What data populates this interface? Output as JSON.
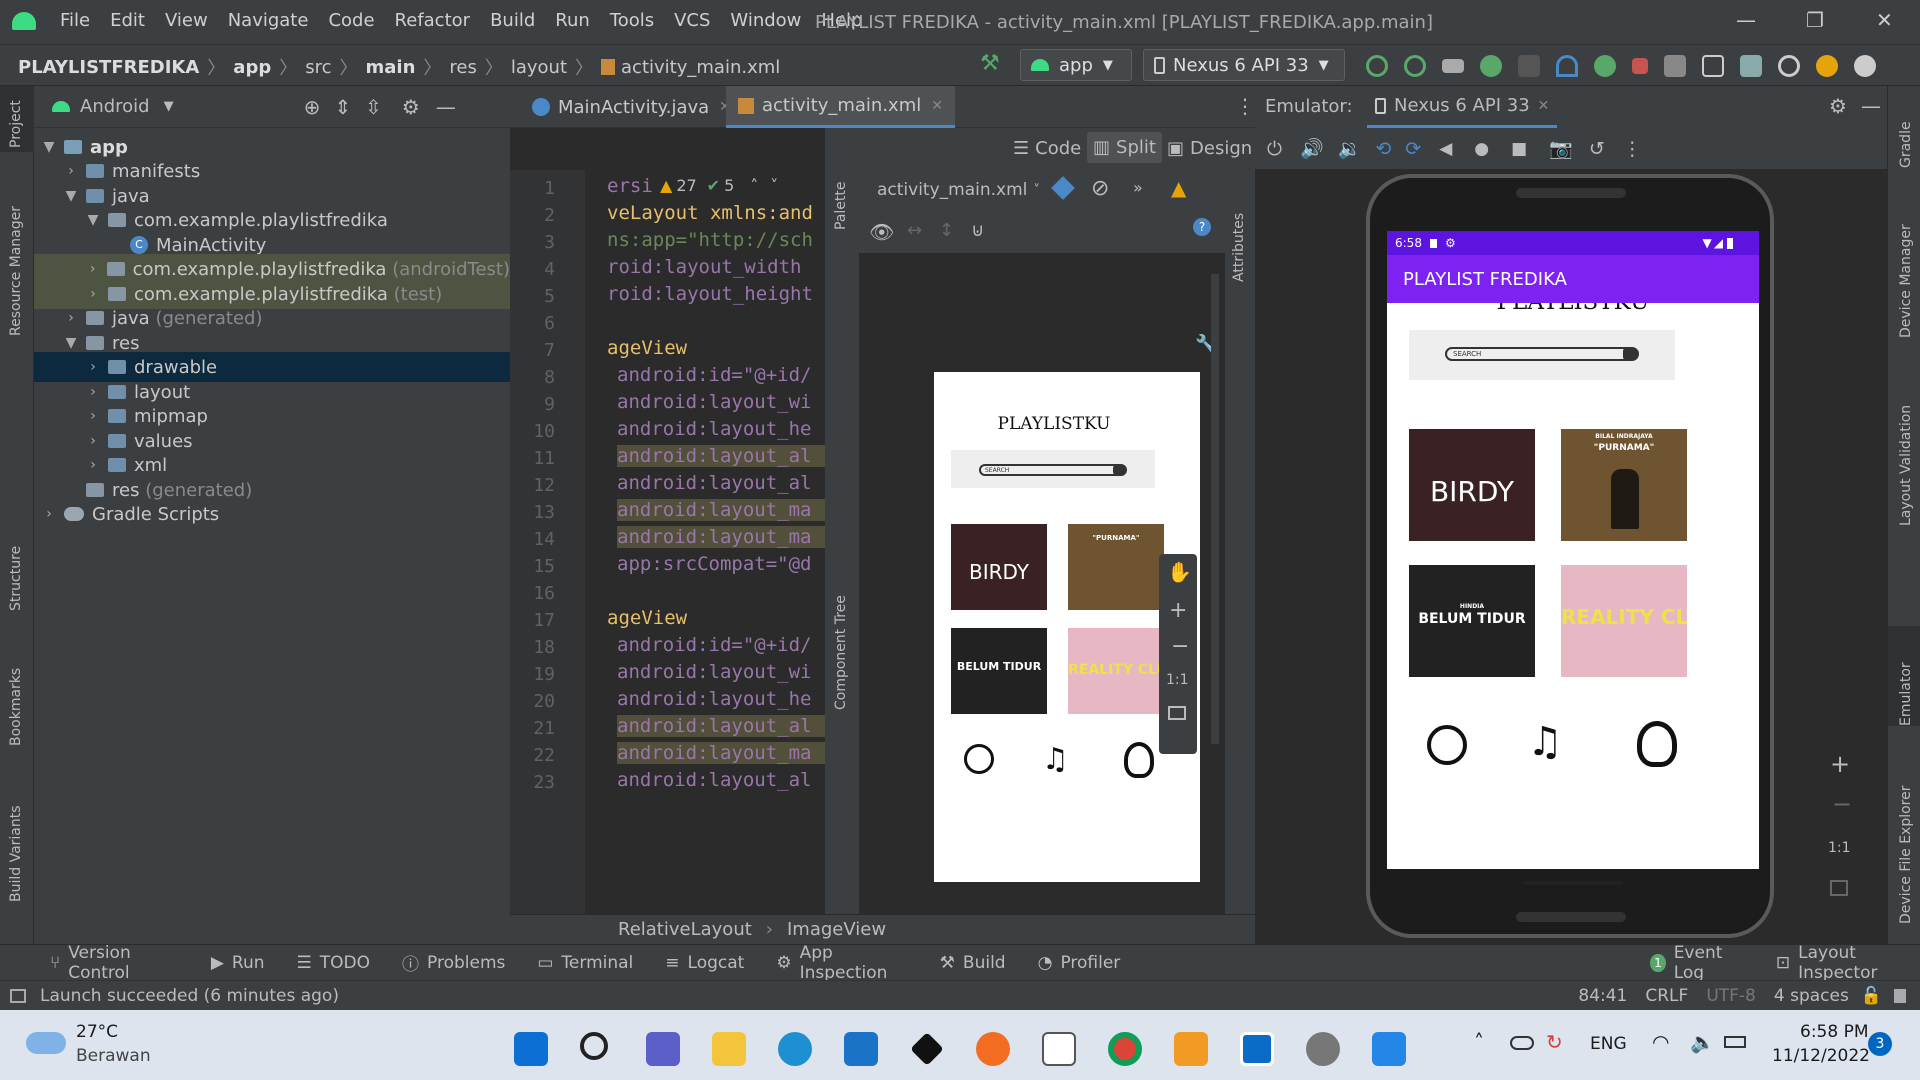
{
  "menubar": {
    "items": [
      "File",
      "Edit",
      "View",
      "Navigate",
      "Code",
      "Refactor",
      "Build",
      "Run",
      "Tools",
      "VCS",
      "Window",
      "Help"
    ],
    "title": "PLAYLIST FREDIKA - activity_main.xml [PLAYLIST_FREDIKA.app.main]"
  },
  "navbar": {
    "crumbs": [
      "PLAYLISTFREDIKA",
      "app",
      "src",
      "main",
      "res",
      "layout",
      "activity_main.xml"
    ],
    "run_config": "app",
    "device": "Nexus 6 API 33"
  },
  "project": {
    "view": "Android",
    "tree": [
      {
        "label": "app",
        "suffix": ""
      },
      {
        "label": "manifests",
        "suffix": ""
      },
      {
        "label": "java",
        "suffix": ""
      },
      {
        "label": "com.example.playlistfredika",
        "suffix": ""
      },
      {
        "label": "MainActivity",
        "suffix": ""
      },
      {
        "label": "com.example.playlistfredika",
        "suffix": "(androidTest)"
      },
      {
        "label": "com.example.playlistfredika",
        "suffix": "(test)"
      },
      {
        "label": "java",
        "suffix": "(generated)"
      },
      {
        "label": "res",
        "suffix": ""
      },
      {
        "label": "drawable",
        "suffix": ""
      },
      {
        "label": "layout",
        "suffix": ""
      },
      {
        "label": "mipmap",
        "suffix": ""
      },
      {
        "label": "values",
        "suffix": ""
      },
      {
        "label": "xml",
        "suffix": ""
      },
      {
        "label": "res",
        "suffix": "(generated)"
      },
      {
        "label": "Gradle Scripts",
        "suffix": ""
      }
    ]
  },
  "left_tool_labels": [
    "Project",
    "Resource Manager",
    "Structure",
    "Bookmarks",
    "Build Variants"
  ],
  "right_tool_labels": [
    "Gradle",
    "Device Manager",
    "Layout Validation",
    "Emulator",
    "Device File Explorer"
  ],
  "editor": {
    "tabs": [
      "MainActivity.java",
      "activity_main.xml"
    ],
    "modes": [
      "Code",
      "Split",
      "Design"
    ],
    "inspections": {
      "warnings": "27",
      "ok": "5"
    },
    "line_numbers": [
      "1",
      "2",
      "3",
      "4",
      "5",
      "6",
      "7",
      "8",
      "9",
      "10",
      "11",
      "12",
      "13",
      "14",
      "15",
      "16",
      "17",
      "18",
      "19",
      "20",
      "21",
      "22",
      "23"
    ],
    "code_lines": [
      "ersi",
      "veLayout xmlns:and",
      "ns:app=\"http://sch",
      "roid:layout_width",
      "roid:layout_height",
      "",
      "ageView",
      "android:id=\"@+id/",
      "android:layout_wi",
      "android:layout_he",
      "android:layout_al",
      "android:layout_al",
      "android:layout_ma",
      "android:layout_ma",
      "app:srcCompat=\"@d",
      "",
      "ageView",
      "android:id=\"@+id/",
      "android:layout_wi",
      "android:layout_he",
      "android:layout_al",
      "android:layout_ma",
      "android:layout_al"
    ],
    "design_file": "activity_main.xml",
    "palette_label": "Palette",
    "component_tree_label": "Component Tree",
    "attributes_label": "Attributes",
    "zoom_ratio": "1:1"
  },
  "breadcrumb_bottom": [
    "RelativeLayout",
    "ImageView"
  ],
  "app_preview": {
    "heading": "PLAYLISTKU",
    "search_placeholder": "SEARCH",
    "albums": [
      "BIRDY",
      "\"PURNAMA\"",
      "BELUM TIDUR",
      "REALITY CLUB"
    ],
    "album_subtitles": {
      "purnama": "BILAL INDRAJAYA",
      "belum": "HINDIA"
    }
  },
  "emulator": {
    "label": "Emulator:",
    "tab": "Nexus 6 API 33",
    "zoom_ratio": "1:1"
  },
  "phone": {
    "time": "6:58",
    "app_title": "PLAYLIST FREDIKA"
  },
  "bottom_tools": [
    "Version Control",
    "Run",
    "TODO",
    "Problems",
    "Terminal",
    "Logcat",
    "App Inspection",
    "Build",
    "Profiler",
    "Event Log",
    "Layout Inspector"
  ],
  "event_log_count": "1",
  "status": {
    "message": "Launch succeeded (6 minutes ago)",
    "position": "84:41",
    "line_sep": "CRLF",
    "encoding": "UTF-8",
    "indent": "4 spaces"
  },
  "taskbar": {
    "temp": "27°C",
    "weather": "Berawan",
    "lang": "ENG",
    "time": "6:58 PM",
    "date": "11/12/2022",
    "notifications": "3"
  },
  "colors": {
    "accent": "#4a88c7",
    "app_purple": "#7d22f0",
    "status_purple": "#5e14e0",
    "warning": "#e5a50a"
  }
}
